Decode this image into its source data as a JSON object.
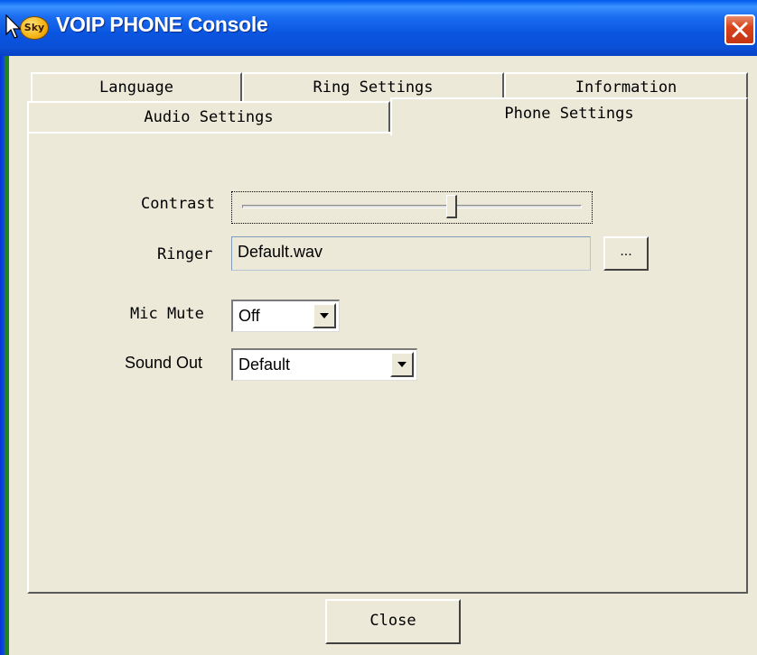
{
  "window": {
    "title": "VOIP PHONE Console",
    "icon_text": "Sky",
    "icon": "app-logo-icon",
    "close_icon": "close-icon"
  },
  "tabs": {
    "back_row": [
      "Language",
      "Ring Settings",
      "Information"
    ],
    "front_row": [
      "Audio Settings",
      "Phone Settings"
    ],
    "active": "Phone Settings"
  },
  "phone_settings": {
    "contrast_label": "Contrast",
    "contrast_level_percent": 62,
    "ringer_label": "Ringer",
    "ringer_value": "Default.wav",
    "browse_label": "...",
    "mic_mute_label": "Mic Mute",
    "mic_mute_value": "Off",
    "sound_out_label": "Sound Out",
    "sound_out_value": "Default"
  },
  "footer": {
    "close_label": "Close"
  },
  "colors": {
    "titlebar": "#0a55e0",
    "face": "#ece9d8",
    "close_button": "#d8431c"
  }
}
